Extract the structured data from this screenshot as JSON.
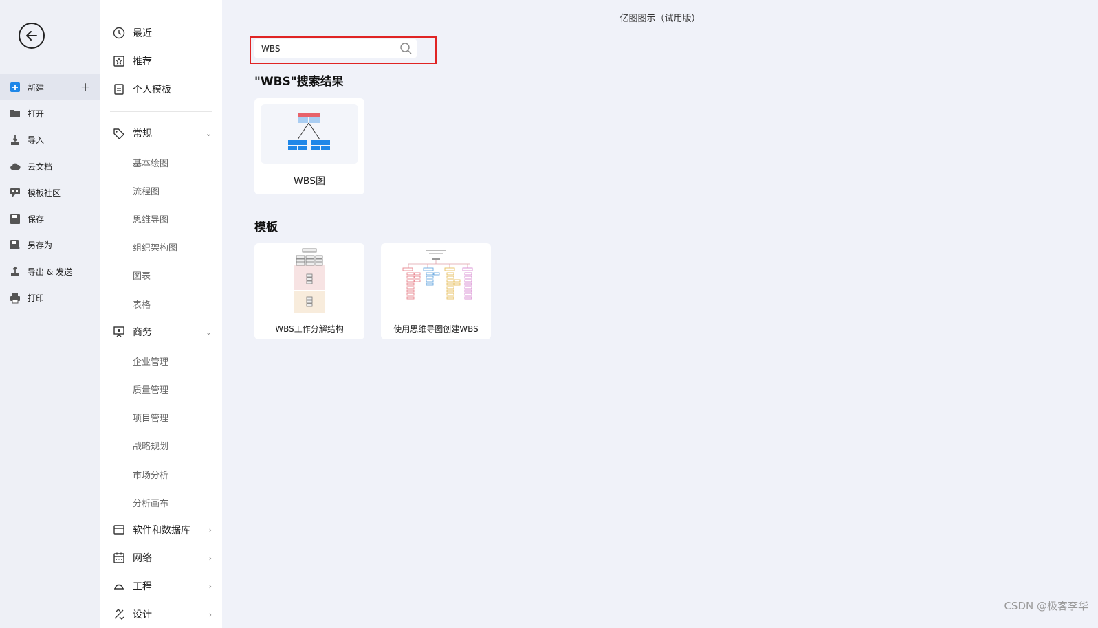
{
  "app_title": "亿图图示（试用版）",
  "left_menu": {
    "items": [
      {
        "label": "新建",
        "icon": "new-file-icon"
      },
      {
        "label": "打开",
        "icon": "folder-icon"
      },
      {
        "label": "导入",
        "icon": "import-icon"
      },
      {
        "label": "云文档",
        "icon": "cloud-icon"
      },
      {
        "label": "模板社区",
        "icon": "community-icon"
      },
      {
        "label": "保存",
        "icon": "save-icon"
      },
      {
        "label": "另存为",
        "icon": "save-as-icon"
      },
      {
        "label": "导出 & 发送",
        "icon": "export-icon"
      },
      {
        "label": "打印",
        "icon": "print-icon"
      }
    ],
    "active_index": 0,
    "new_plus": "+"
  },
  "category_menu": {
    "top_items": [
      {
        "label": "最近",
        "icon": "clock-icon"
      },
      {
        "label": "推荐",
        "icon": "recommend-icon"
      },
      {
        "label": "个人模板",
        "icon": "personal-template-icon"
      }
    ],
    "groups": [
      {
        "label": "常规",
        "icon": "tag-icon",
        "expanded": true,
        "subs": [
          "基本绘图",
          "流程图",
          "思维导图",
          "组织架构图",
          "图表",
          "表格"
        ]
      },
      {
        "label": "商务",
        "icon": "presentation-icon",
        "expanded": true,
        "subs": [
          "企业管理",
          "质量管理",
          "项目管理",
          "战略规划",
          "市场分析",
          "分析画布"
        ]
      },
      {
        "label": "软件和数据库",
        "icon": "window-icon",
        "expanded": false,
        "subs": []
      },
      {
        "label": "网络",
        "icon": "calendar-icon",
        "expanded": false,
        "subs": []
      },
      {
        "label": "工程",
        "icon": "helmet-icon",
        "expanded": false,
        "subs": []
      },
      {
        "label": "设计",
        "icon": "design-icon",
        "expanded": false,
        "subs": []
      }
    ]
  },
  "search": {
    "value": "WBS",
    "placeholder": ""
  },
  "results": {
    "title": "\"WBS\"搜索结果",
    "items": [
      {
        "label": "WBS图",
        "icon": "wbs-diagram-icon"
      }
    ]
  },
  "templates": {
    "title": "模板",
    "items": [
      {
        "label": "WBS工作分解结构"
      },
      {
        "label": "使用思维导图创建WBS"
      }
    ]
  },
  "watermark": "CSDN @极客李华",
  "colors": {
    "accent": "#1f87e8",
    "search_highlight": "#e02424",
    "wbs_top": "#e8626a",
    "wbs_mid": "#a9cdf2",
    "wbs_bottom": "#1f87e8"
  }
}
